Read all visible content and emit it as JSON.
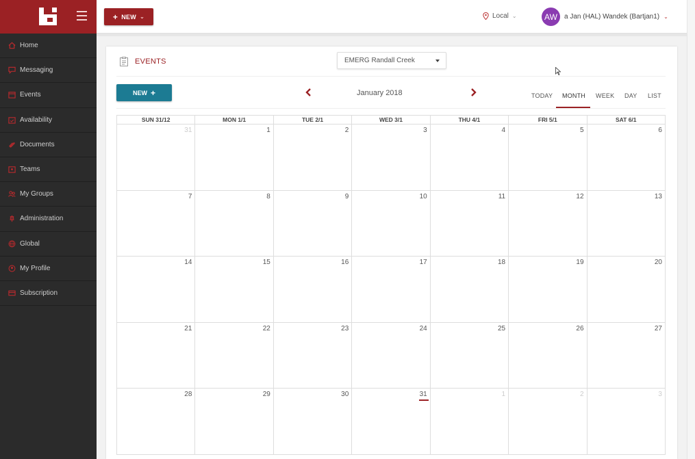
{
  "sidebar": {
    "items": [
      {
        "label": "Home",
        "icon": "home-icon"
      },
      {
        "label": "Messaging",
        "icon": "chat-icon"
      },
      {
        "label": "Events",
        "icon": "calendar-icon"
      },
      {
        "label": "Availability",
        "icon": "calendar-check-icon"
      },
      {
        "label": "Documents",
        "icon": "paperclip-icon"
      },
      {
        "label": "Teams",
        "icon": "team-icon"
      },
      {
        "label": "My Groups",
        "icon": "groups-icon"
      },
      {
        "label": "Administration",
        "icon": "admin-icon"
      },
      {
        "label": "Global",
        "icon": "globe-icon"
      },
      {
        "label": "My Profile",
        "icon": "profile-icon"
      },
      {
        "label": "Subscription",
        "icon": "subscription-icon"
      }
    ]
  },
  "topbar": {
    "new_label": "NEW",
    "location": "Local",
    "avatar_initials": "AW",
    "user_name": "a Jan (HAL) Wandek (Bartjan1)"
  },
  "panel": {
    "title": "EVENTS",
    "group_select_value": "EMERG Randall Creek"
  },
  "calendar": {
    "new_label": "NEW",
    "month_label": "January 2018",
    "view_tabs": [
      "TODAY",
      "MONTH",
      "WEEK",
      "DAY",
      "LIST"
    ],
    "active_view": "MONTH",
    "day_headers": [
      "SUN 31/12",
      "MON 1/1",
      "TUE 2/1",
      "WED 3/1",
      "THU 4/1",
      "FRI 5/1",
      "SAT 6/1"
    ],
    "weeks": [
      [
        {
          "n": "31",
          "other": true
        },
        {
          "n": "1"
        },
        {
          "n": "2"
        },
        {
          "n": "3"
        },
        {
          "n": "4"
        },
        {
          "n": "5"
        },
        {
          "n": "6"
        }
      ],
      [
        {
          "n": "7"
        },
        {
          "n": "8"
        },
        {
          "n": "9"
        },
        {
          "n": "10"
        },
        {
          "n": "11"
        },
        {
          "n": "12"
        },
        {
          "n": "13"
        }
      ],
      [
        {
          "n": "14"
        },
        {
          "n": "15"
        },
        {
          "n": "16"
        },
        {
          "n": "17"
        },
        {
          "n": "18"
        },
        {
          "n": "19"
        },
        {
          "n": "20"
        }
      ],
      [
        {
          "n": "21"
        },
        {
          "n": "22"
        },
        {
          "n": "23"
        },
        {
          "n": "24"
        },
        {
          "n": "25"
        },
        {
          "n": "26"
        },
        {
          "n": "27"
        }
      ],
      [
        {
          "n": "28"
        },
        {
          "n": "29"
        },
        {
          "n": "30"
        },
        {
          "n": "31",
          "today": true
        },
        {
          "n": "1",
          "other": true
        },
        {
          "n": "2",
          "other": true
        },
        {
          "n": "3",
          "other": true
        }
      ]
    ]
  },
  "colors": {
    "brand": "#9b2124",
    "accent_button": "#1c7b93",
    "sidebar_bg": "#2b2b2b",
    "avatar_bg": "#8a3bb1"
  }
}
